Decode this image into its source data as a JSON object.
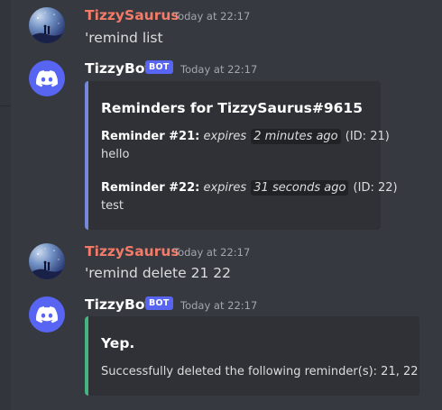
{
  "messages": [
    {
      "author": "TizzySaurus",
      "timestamp": "Today at 22:17",
      "content": "'remind list"
    },
    {
      "author": "TizzyBot",
      "bot_tag": "BOT",
      "timestamp": "Today at 22:17",
      "embed": {
        "accent_color": "#7289da",
        "title": "Reminders for TizzySaurus#9615",
        "fields": [
          {
            "label": "Reminder #21:",
            "expires_word": "expires",
            "expires_value": "2 minutes ago",
            "id_text": "(ID: 21)",
            "body": "hello"
          },
          {
            "label": "Reminder #22:",
            "expires_word": "expires",
            "expires_value": "31 seconds ago",
            "id_text": "(ID: 22)",
            "body": "test"
          }
        ]
      }
    },
    {
      "author": "TizzySaurus",
      "timestamp": "Today at 22:17",
      "content": "'remind delete 21 22"
    },
    {
      "author": "TizzyBot",
      "bot_tag": "BOT",
      "timestamp": "Today at 22:17",
      "embed": {
        "accent_color": "#43b581",
        "title": "Yep.",
        "description": "Successfully deleted the following reminder(s): 21, 22"
      }
    }
  ],
  "colors": {
    "background": "#36393f",
    "user_name": "#f47b67",
    "bot_name": "#ffffff",
    "blurple": "#5865f2",
    "embed_bg": "#2f3136",
    "timestamp": "#a3a6aa"
  },
  "icons": {
    "user_avatar": "user-avatar",
    "bot_avatar": "discord-logo-icon"
  }
}
